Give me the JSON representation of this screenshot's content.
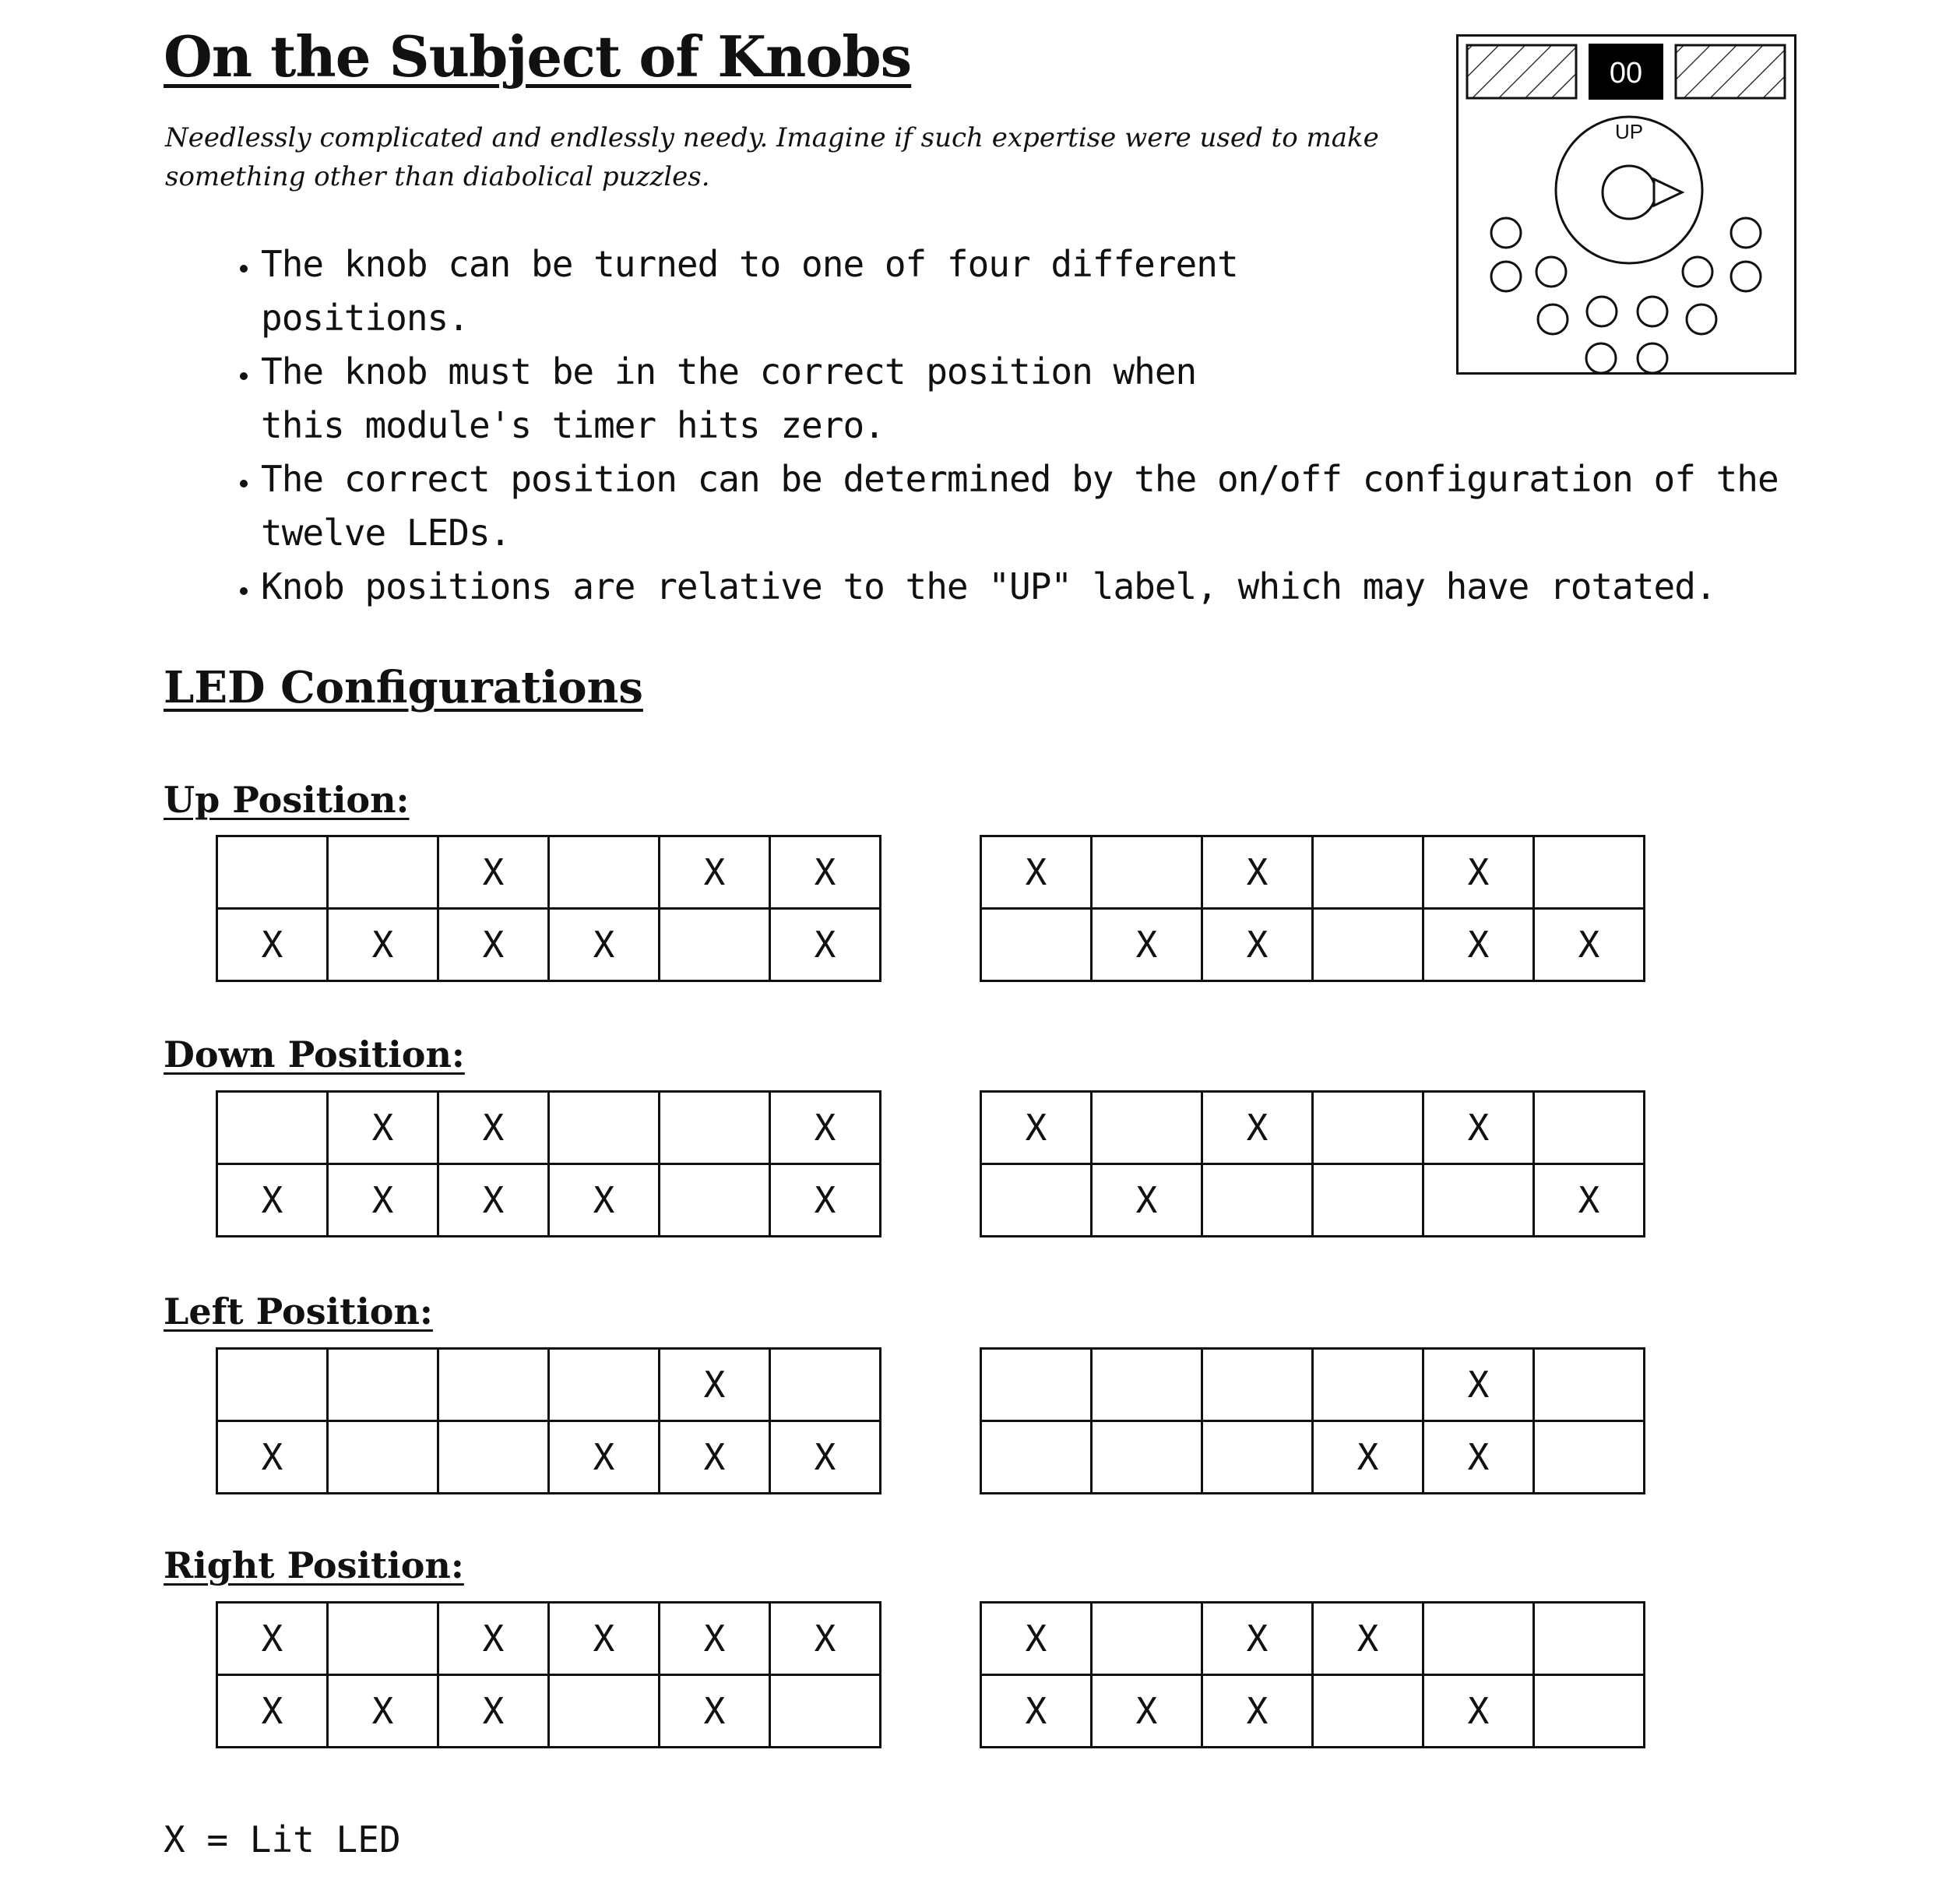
{
  "title": "On the Subject of Knobs",
  "subtitle": "Needlessly complicated and endlessly needy. Imagine if such expertise were used to make something other than diabolical puzzles.",
  "bullets": [
    "The knob can be turned to one of four different positions.",
    "The knob must be in the correct position when this module's timer hits zero.",
    "The correct position can be determined by the on/off configuration of the twelve LEDs.",
    "Knob positions are relative to the \"UP\" label, which may have rotated."
  ],
  "module": {
    "timer": "00",
    "up_label": "UP"
  },
  "section_title": "LED Configurations",
  "legend": "X = Lit LED",
  "positions": [
    {
      "label": "Up Position:",
      "tables": [
        [
          [
            "",
            "",
            "X",
            "",
            "X",
            "X"
          ],
          [
            "X",
            "X",
            "X",
            "X",
            "",
            "X"
          ]
        ],
        [
          [
            "X",
            "",
            "X",
            "",
            "X",
            ""
          ],
          [
            "",
            "X",
            "X",
            "",
            "X",
            "X"
          ]
        ]
      ]
    },
    {
      "label": "Down Position:",
      "tables": [
        [
          [
            "",
            "X",
            "X",
            "",
            "",
            "X"
          ],
          [
            "X",
            "X",
            "X",
            "X",
            "",
            "X"
          ]
        ],
        [
          [
            "X",
            "",
            "X",
            "",
            "X",
            ""
          ],
          [
            "",
            "X",
            "",
            "",
            "",
            "X"
          ]
        ]
      ]
    },
    {
      "label": "Left Position:",
      "tables": [
        [
          [
            "",
            "",
            "",
            "",
            "X",
            ""
          ],
          [
            "X",
            "",
            "",
            "X",
            "X",
            "X"
          ]
        ],
        [
          [
            "",
            "",
            "",
            "",
            "X",
            ""
          ],
          [
            "",
            "",
            "",
            "X",
            "X",
            ""
          ]
        ]
      ]
    },
    {
      "label": "Right Position:",
      "tables": [
        [
          [
            "X",
            "",
            "X",
            "X",
            "X",
            "X"
          ],
          [
            "X",
            "X",
            "X",
            "",
            "X",
            ""
          ]
        ],
        [
          [
            "X",
            "",
            "X",
            "X",
            "",
            ""
          ],
          [
            "X",
            "X",
            "X",
            "",
            "X",
            ""
          ]
        ]
      ]
    }
  ]
}
